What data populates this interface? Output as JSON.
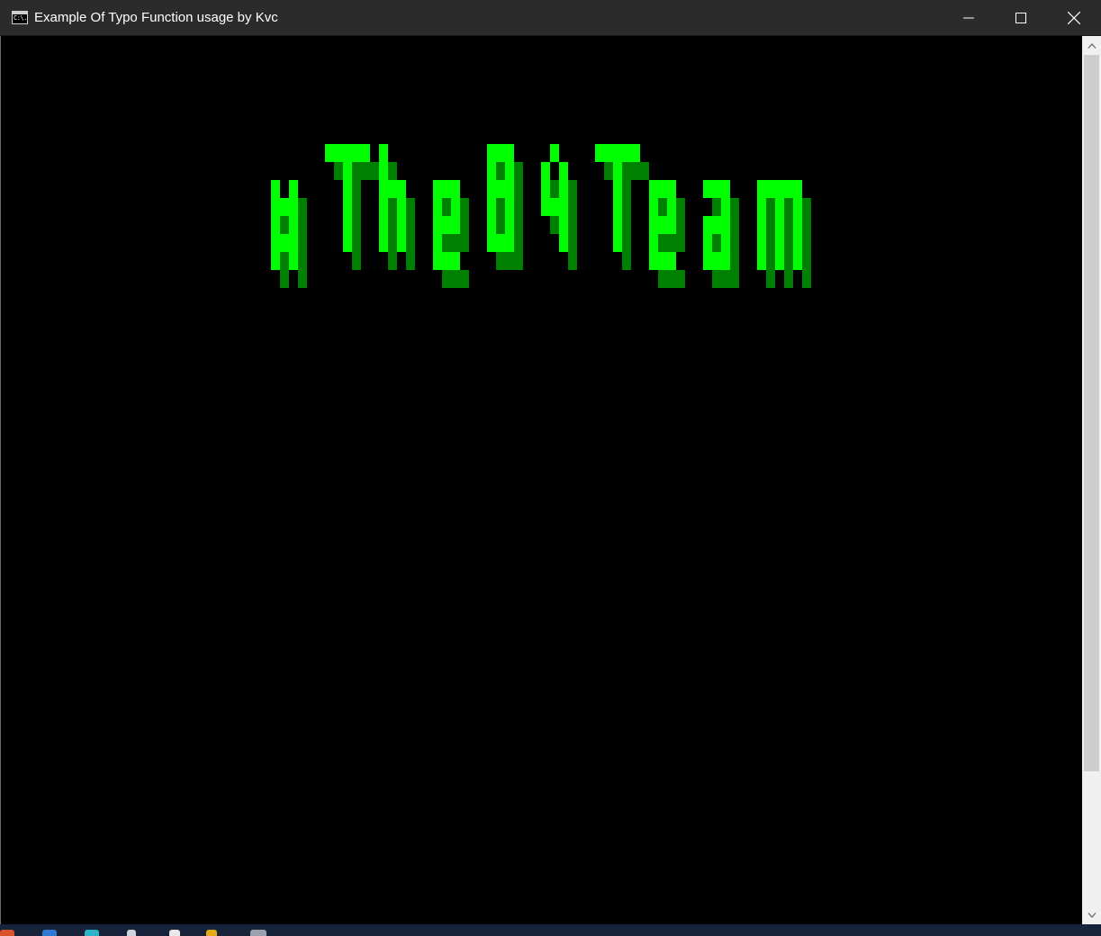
{
  "window": {
    "title": "Example Of Typo Function usage by Kvc",
    "icon": "console-icon",
    "icon_text": "C:\\."
  },
  "controls": {
    "minimize": "minimize-icon",
    "maximize": "maximize-icon",
    "close": "close-icon"
  },
  "console": {
    "background": "#000000",
    "art_text": "#TheB4Team",
    "art_color_bright": "#00ff00",
    "art_color_shadow": "#008000"
  },
  "scrollbar": {
    "up": "scroll-up-arrow-icon",
    "down": "scroll-down-arrow-icon"
  },
  "taskbar": {
    "background": "#16233a"
  }
}
